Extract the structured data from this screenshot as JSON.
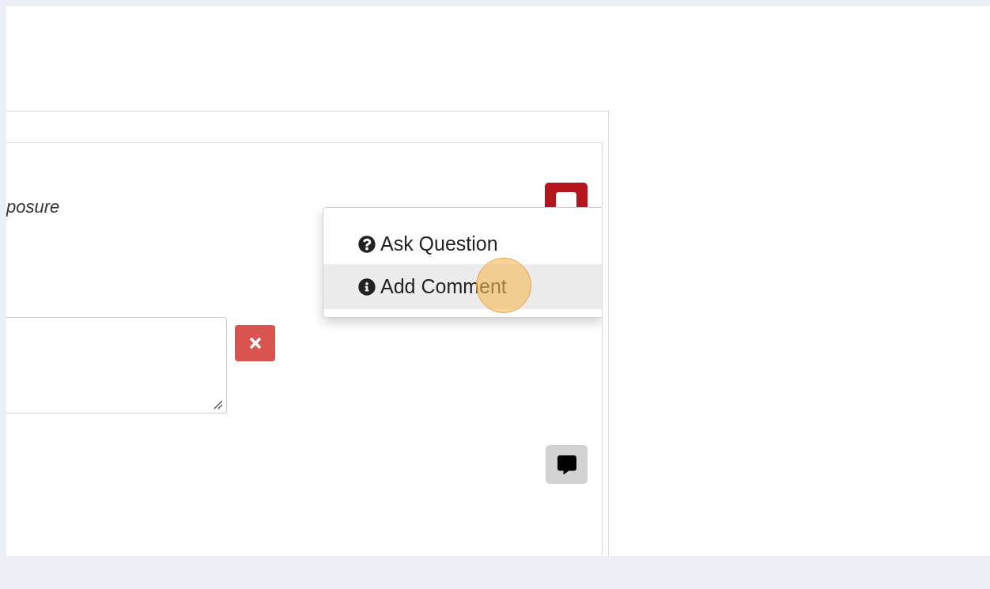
{
  "question": {
    "text": "posure"
  },
  "comment_menu": {
    "items": [
      {
        "kind": "question",
        "label": "Ask Question",
        "hovered": false
      },
      {
        "kind": "info",
        "label": "Add Comment",
        "hovered": true
      }
    ]
  }
}
